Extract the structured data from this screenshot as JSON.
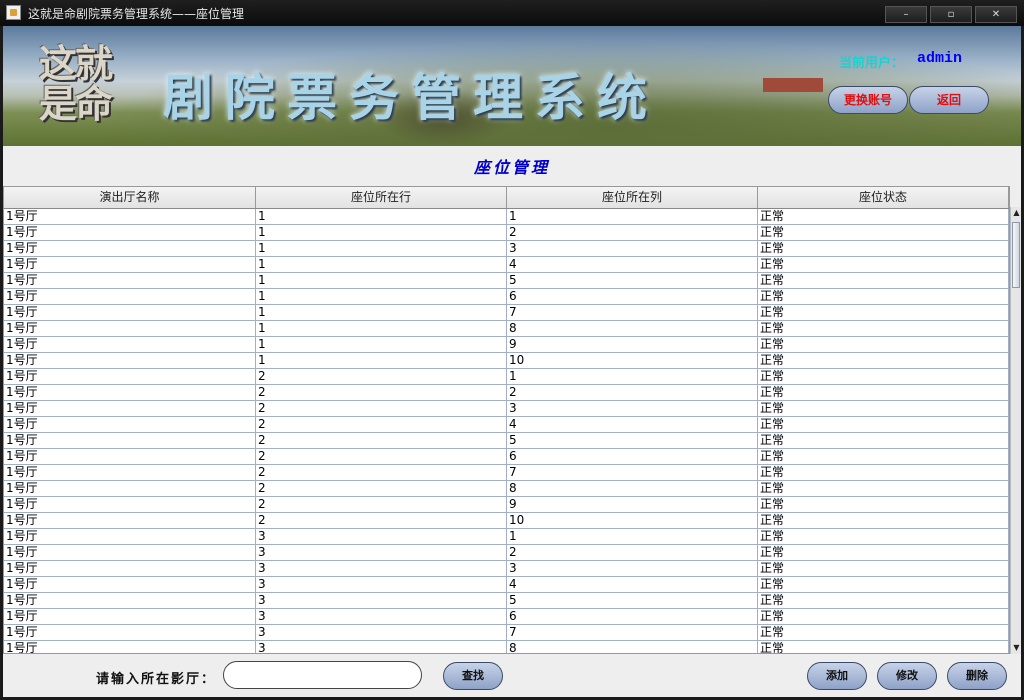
{
  "window": {
    "title": "这就是命剧院票务管理系统——座位管理",
    "controls": {
      "minimize": "–",
      "maximize": "▫",
      "close": "✕"
    }
  },
  "banner": {
    "logo_text_line1": "这就",
    "logo_text_line2": "是命",
    "system_title": "剧院票务管理系统",
    "user_label": "当前用户：",
    "user_name": "admin",
    "switch_account_label": "更换账号",
    "back_label": "返回"
  },
  "page": {
    "section_title": "座位管理"
  },
  "table": {
    "columns": [
      "演出厅名称",
      "座位所在行",
      "座位所在列",
      "座位状态"
    ],
    "rows": [
      [
        "1号厅",
        "1",
        "1",
        "正常"
      ],
      [
        "1号厅",
        "1",
        "2",
        "正常"
      ],
      [
        "1号厅",
        "1",
        "3",
        "正常"
      ],
      [
        "1号厅",
        "1",
        "4",
        "正常"
      ],
      [
        "1号厅",
        "1",
        "5",
        "正常"
      ],
      [
        "1号厅",
        "1",
        "6",
        "正常"
      ],
      [
        "1号厅",
        "1",
        "7",
        "正常"
      ],
      [
        "1号厅",
        "1",
        "8",
        "正常"
      ],
      [
        "1号厅",
        "1",
        "9",
        "正常"
      ],
      [
        "1号厅",
        "1",
        "10",
        "正常"
      ],
      [
        "1号厅",
        "2",
        "1",
        "正常"
      ],
      [
        "1号厅",
        "2",
        "2",
        "正常"
      ],
      [
        "1号厅",
        "2",
        "3",
        "正常"
      ],
      [
        "1号厅",
        "2",
        "4",
        "正常"
      ],
      [
        "1号厅",
        "2",
        "5",
        "正常"
      ],
      [
        "1号厅",
        "2",
        "6",
        "正常"
      ],
      [
        "1号厅",
        "2",
        "7",
        "正常"
      ],
      [
        "1号厅",
        "2",
        "8",
        "正常"
      ],
      [
        "1号厅",
        "2",
        "9",
        "正常"
      ],
      [
        "1号厅",
        "2",
        "10",
        "正常"
      ],
      [
        "1号厅",
        "3",
        "1",
        "正常"
      ],
      [
        "1号厅",
        "3",
        "2",
        "正常"
      ],
      [
        "1号厅",
        "3",
        "3",
        "正常"
      ],
      [
        "1号厅",
        "3",
        "4",
        "正常"
      ],
      [
        "1号厅",
        "3",
        "5",
        "正常"
      ],
      [
        "1号厅",
        "3",
        "6",
        "正常"
      ],
      [
        "1号厅",
        "3",
        "7",
        "正常"
      ],
      [
        "1号厅",
        "3",
        "8",
        "正常"
      ]
    ]
  },
  "footer": {
    "search_label": "请输入所在影厅：",
    "search_value": "",
    "search_button": "查找",
    "add_button": "添加",
    "edit_button": "修改",
    "delete_button": "删除"
  },
  "icons": {
    "app_icon": "java-cup-icon",
    "scroll_up": "▲",
    "scroll_down": "▼"
  }
}
